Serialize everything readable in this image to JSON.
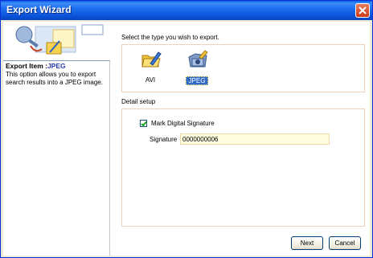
{
  "window": {
    "title": "Export Wizard"
  },
  "left_panel": {
    "item_title_prefix": "Export Item :",
    "item_title_value": "JPEG",
    "description": "This option allows you to export search results into a JPEG image."
  },
  "export_types": {
    "prompt": "Select the type you wish to export.",
    "options": [
      {
        "label": "AVI",
        "icon": "folder-pencil-icon",
        "selected": false
      },
      {
        "label": "JPEG",
        "icon": "camera-folder-icon",
        "selected": true
      }
    ]
  },
  "detail_setup": {
    "label": "Detail setup",
    "mark_signature": {
      "label": "Mark Digital Signature",
      "checked": true
    },
    "signature": {
      "label": "Signature",
      "value": "0000000006"
    }
  },
  "buttons": {
    "next": "Next",
    "cancel": "Cancel"
  },
  "colors": {
    "titlebar": "#0a52d8",
    "close": "#cc3a1a",
    "selection": "#316ac5",
    "item_highlight": "#2a3aa8",
    "frame_border": "#f0d0b8",
    "input_bg": "#fffde0"
  }
}
